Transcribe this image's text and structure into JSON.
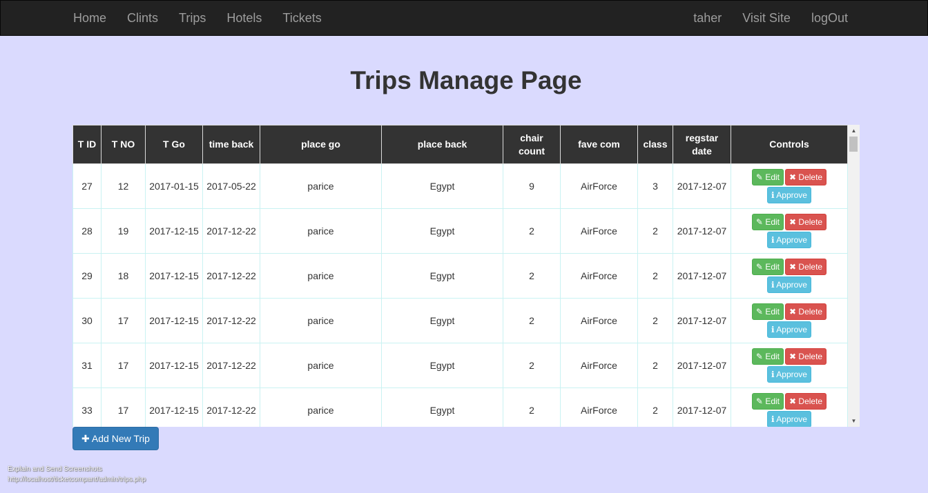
{
  "nav": {
    "left": [
      "Home",
      "Clints",
      "Trips",
      "Hotels",
      "Tickets"
    ],
    "right": [
      "taher",
      "Visit Site",
      "logOut"
    ]
  },
  "title": "Trips Manage Page",
  "table": {
    "headers": [
      "T ID",
      "T NO",
      "T Go",
      "time back",
      "place go",
      "place back",
      "chair count",
      "fave com",
      "class",
      "regstar date",
      "Controls"
    ],
    "rows": [
      [
        "27",
        "12",
        "2017-01-15",
        "2017-05-22",
        "parice",
        "Egypt",
        "9",
        "AirForce",
        "3",
        "2017-12-07"
      ],
      [
        "28",
        "19",
        "2017-12-15",
        "2017-12-22",
        "parice",
        "Egypt",
        "2",
        "AirForce",
        "2",
        "2017-12-07"
      ],
      [
        "29",
        "18",
        "2017-12-15",
        "2017-12-22",
        "parice",
        "Egypt",
        "2",
        "AirForce",
        "2",
        "2017-12-07"
      ],
      [
        "30",
        "17",
        "2017-12-15",
        "2017-12-22",
        "parice",
        "Egypt",
        "2",
        "AirForce",
        "2",
        "2017-12-07"
      ],
      [
        "31",
        "17",
        "2017-12-15",
        "2017-12-22",
        "parice",
        "Egypt",
        "2",
        "AirForce",
        "2",
        "2017-12-07"
      ],
      [
        "33",
        "17",
        "2017-12-15",
        "2017-12-22",
        "parice",
        "Egypt",
        "2",
        "AirForce",
        "2",
        "2017-12-07"
      ]
    ],
    "buttons": {
      "edit": "Edit",
      "delete": "Delete",
      "approve": "Approve",
      "edit_icon": "edit-icon",
      "delete_icon": "close-icon",
      "approve_icon": "info-icon"
    }
  },
  "add_button": {
    "icon": "plus-icon",
    "label": "Add New Trip"
  },
  "footer": {
    "line1": "Explain and Send Screenshots",
    "line2": "http://localhost/ticketcompant/admin/trips.php"
  },
  "colors": {
    "page_bg": "#dadafe",
    "navbar_bg": "#222222",
    "header_bg": "#333333",
    "edit": "#5cb85c",
    "delete": "#d9534f",
    "approve": "#5bc0de",
    "primary": "#337ab7"
  }
}
